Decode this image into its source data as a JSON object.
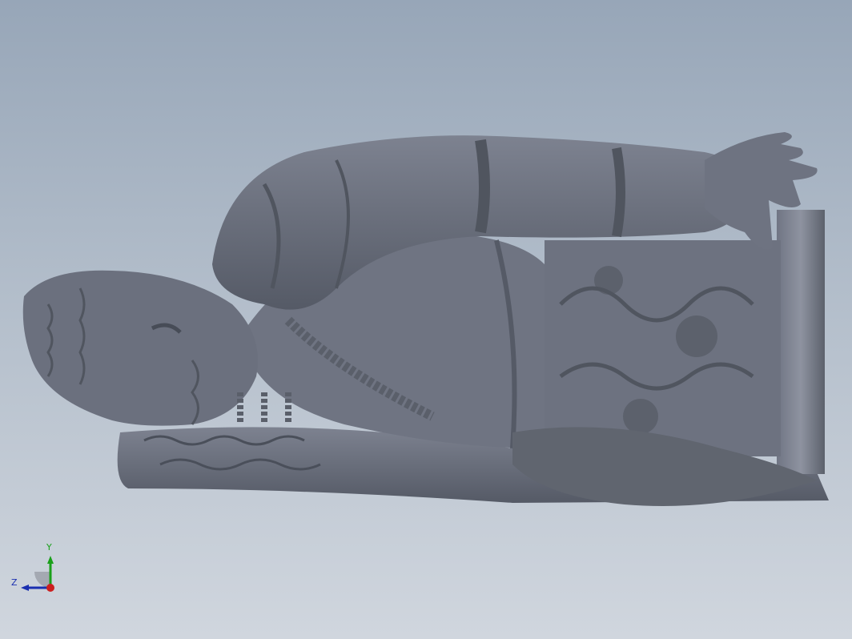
{
  "viewport": {
    "background_top": "#97a6b8",
    "background_bottom": "#d0d6de",
    "model_color": "#676c78"
  },
  "triad": {
    "y_label": "Y",
    "z_label": "Z",
    "x_axis_color": "#cc1f1f",
    "y_axis_color": "#1aa01a",
    "z_axis_color": "#1a2fb0"
  }
}
